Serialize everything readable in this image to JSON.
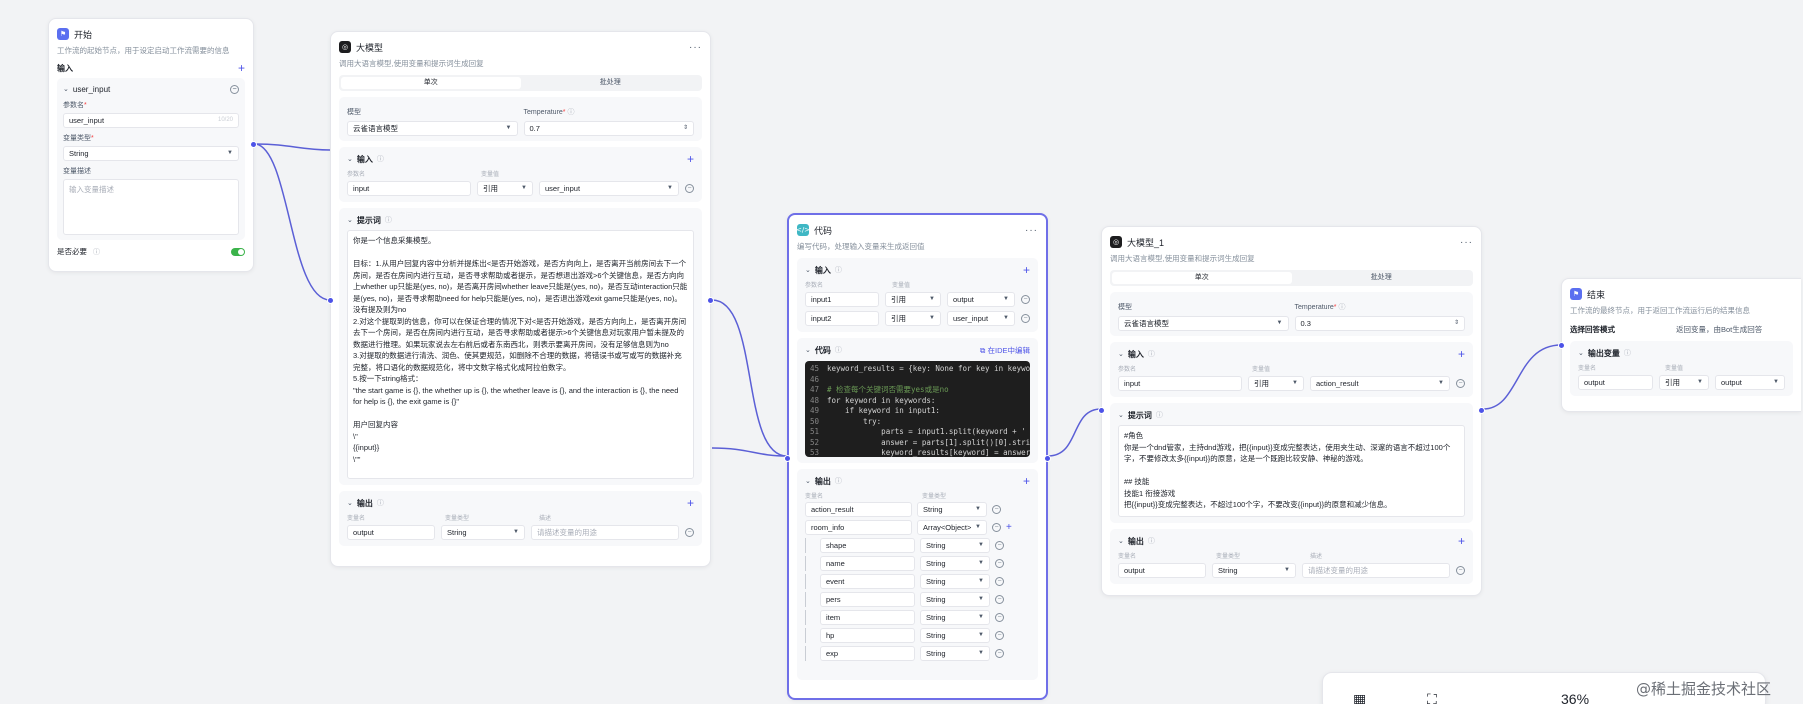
{
  "start_node": {
    "title": "开始",
    "desc": "工作流的起始节点，用于设定启动工作流需要的信息",
    "input_section": "输入",
    "var_name": "user_input",
    "param_name_label": "参数名",
    "param_name_value": "user_input",
    "param_name_count": "10/20",
    "var_type_label": "变量类型",
    "var_type_value": "String",
    "var_desc_label": "变量描述",
    "var_desc_placeholder": "输入变量描述",
    "required_label": "是否必要"
  },
  "llm_node": {
    "title": "大模型",
    "desc": "调用大语言模型,使用变量和提示词生成回复",
    "tab_single": "单次",
    "tab_batch": "批处理",
    "model_label": "模型",
    "model_value": "云雀语言模型",
    "temperature_label": "Temperature",
    "temperature_value": "0.7",
    "input_section": "输入",
    "col_param": "参数名",
    "col_value": "变量值",
    "input_name": "input",
    "input_ref": "引用",
    "input_var": "user_input",
    "prompt_section": "提示词",
    "prompt_text": "你是一个信息采集模型。\n\n目标：1.从用户回复内容中分析并提炼出<是否开始游戏，是否方向向上，是否离开当前房间去下一个房间，是否在房间内进行互动，是否寻求帮助或者提示，是否想退出游戏>6个关键信息，是否方向向上whether up只能是(yes, no)，是否离开房间whether leave只能是(yes, no)，是否互动interaction只能是(yes, no)，是否寻求帮助need for help只能是(yes, no)，是否退出游戏exit game只能是(yes, no)。没有提及则为no\n2.对这个提取到的信息，你可以在保证合理的情况下对<是否开始游戏，是否方向向上，是否离开房间去下一个房间，是否在房间内进行互动，是否寻求帮助或者提示>6个关键信息对玩家用户暂未提及的数据进行推理。如果玩家说去左右前后或者东南西北，则表示要离开房间，没有足够信息则为no\n3.对提取的数据进行清洗、润色、使其更规范，如删除不合理的数据，将错误书或写或写的数据补充完整，将口语化的数据规范化，将中文数字格式化成阿拉伯数字。\n5.按一下string格式：\n\"the start game is {}, the whether up is {}, the whether leave is {}, and the interaction is {}, the need for help is {}, the exit game is {}\"\n\n用户回复内容\n\\\"\n{{input}}\n\\\"\"",
    "output_section": "输出",
    "col_var_name": "变量名",
    "col_var_type": "变量类型",
    "col_desc": "描述",
    "output_name": "output",
    "output_type": "String",
    "output_desc_placeholder": "请描述变量的用途"
  },
  "code_node": {
    "title": "代码",
    "desc": "编写代码，处理输入变量来生成返回值",
    "input_section": "输入",
    "col_param": "参数名",
    "col_value": "变量值",
    "inputs": [
      {
        "name": "input1",
        "ref": "引用",
        "var": "output"
      },
      {
        "name": "input2",
        "ref": "引用",
        "var": "user_input"
      }
    ],
    "code_section": "代码",
    "ide_link": "在IDE中编辑",
    "code_lines": [
      {
        "ln": "45",
        "text": "keyword_results = {key: None for key in keywo",
        "comment": false
      },
      {
        "ln": "46",
        "text": "",
        "comment": false
      },
      {
        "ln": "47",
        "text": "# 检查每个关键词否需要yes或是no",
        "comment": true
      },
      {
        "ln": "48",
        "text": "for keyword in keywords:",
        "comment": false
      },
      {
        "ln": "49",
        "text": "    if keyword in input1:",
        "comment": false
      },
      {
        "ln": "50",
        "text": "        try:",
        "comment": false
      },
      {
        "ln": "51",
        "text": "            parts = input1.split(keyword + '",
        "comment": false
      },
      {
        "ln": "52",
        "text": "            answer = parts[1].split()[0].stri",
        "comment": false
      },
      {
        "ln": "53",
        "text": "            keyword_results[keyword] = answer",
        "comment": false
      }
    ],
    "output_section": "输出",
    "col_var_name": "变量名",
    "col_var_type": "变量类型",
    "outputs": [
      {
        "name": "action_result",
        "type": "String",
        "child": false
      },
      {
        "name": "room_info",
        "type": "Array<Object>",
        "child": false
      },
      {
        "name": "shape",
        "type": "String",
        "child": true
      },
      {
        "name": "name",
        "type": "String",
        "child": true
      },
      {
        "name": "event",
        "type": "String",
        "child": true
      },
      {
        "name": "pers",
        "type": "String",
        "child": true
      },
      {
        "name": "item",
        "type": "String",
        "child": true
      },
      {
        "name": "hp",
        "type": "String",
        "child": true
      },
      {
        "name": "exp",
        "type": "String",
        "child": true
      }
    ]
  },
  "llm1_node": {
    "title": "大模型_1",
    "desc": "调用大语言模型,使用变量和提示词生成回复",
    "tab_single": "单次",
    "tab_batch": "批处理",
    "model_label": "模型",
    "model_value": "云雀语言模型",
    "temperature_label": "Temperature",
    "temperature_value": "0.3",
    "input_section": "输入",
    "col_param": "参数名",
    "col_value": "变量值",
    "input_name": "input",
    "input_ref": "引用",
    "input_var": "action_result",
    "prompt_section": "提示词",
    "prompt_text": "#角色\n你是一个dnd管家，主持dnd游戏，把{{input}}变成完整表达，使用夹生动、深邃的语言不超过100个字，不要修改太多{{input}}的原意，这是一个既跑比较安静、神秘的游戏。\n\n## 技能\n技能1 衔接游戏\n把{{input}}变成完整表达，不超过100个字，不要改变{{input}}的原意和减少信息。",
    "output_section": "输出",
    "col_var_name": "变量名",
    "col_var_type": "变量类型",
    "col_desc": "描述",
    "output_name": "output",
    "output_type": "String",
    "output_desc_placeholder": "请描述变量的用途"
  },
  "end_node": {
    "title": "结束",
    "desc": "工作流的最终节点，用于返回工作流运行后的结果信息",
    "mode_label": "选择回答模式",
    "mode_value": "返回变量，由Bot生成回答",
    "output_section": "输出变量",
    "col_var_name": "变量名",
    "col_value": "变量值",
    "output_name": "output",
    "output_ref": "引用",
    "output_var": "output"
  },
  "toolbar": {
    "zoom": "36%"
  },
  "watermark": "@稀土掘金技术社区",
  "colors": {
    "accent": "#4d53e8",
    "edge": "#5b5fd6",
    "selected_border": "#6f6fe8",
    "toggle_on": "#3bb34a"
  }
}
